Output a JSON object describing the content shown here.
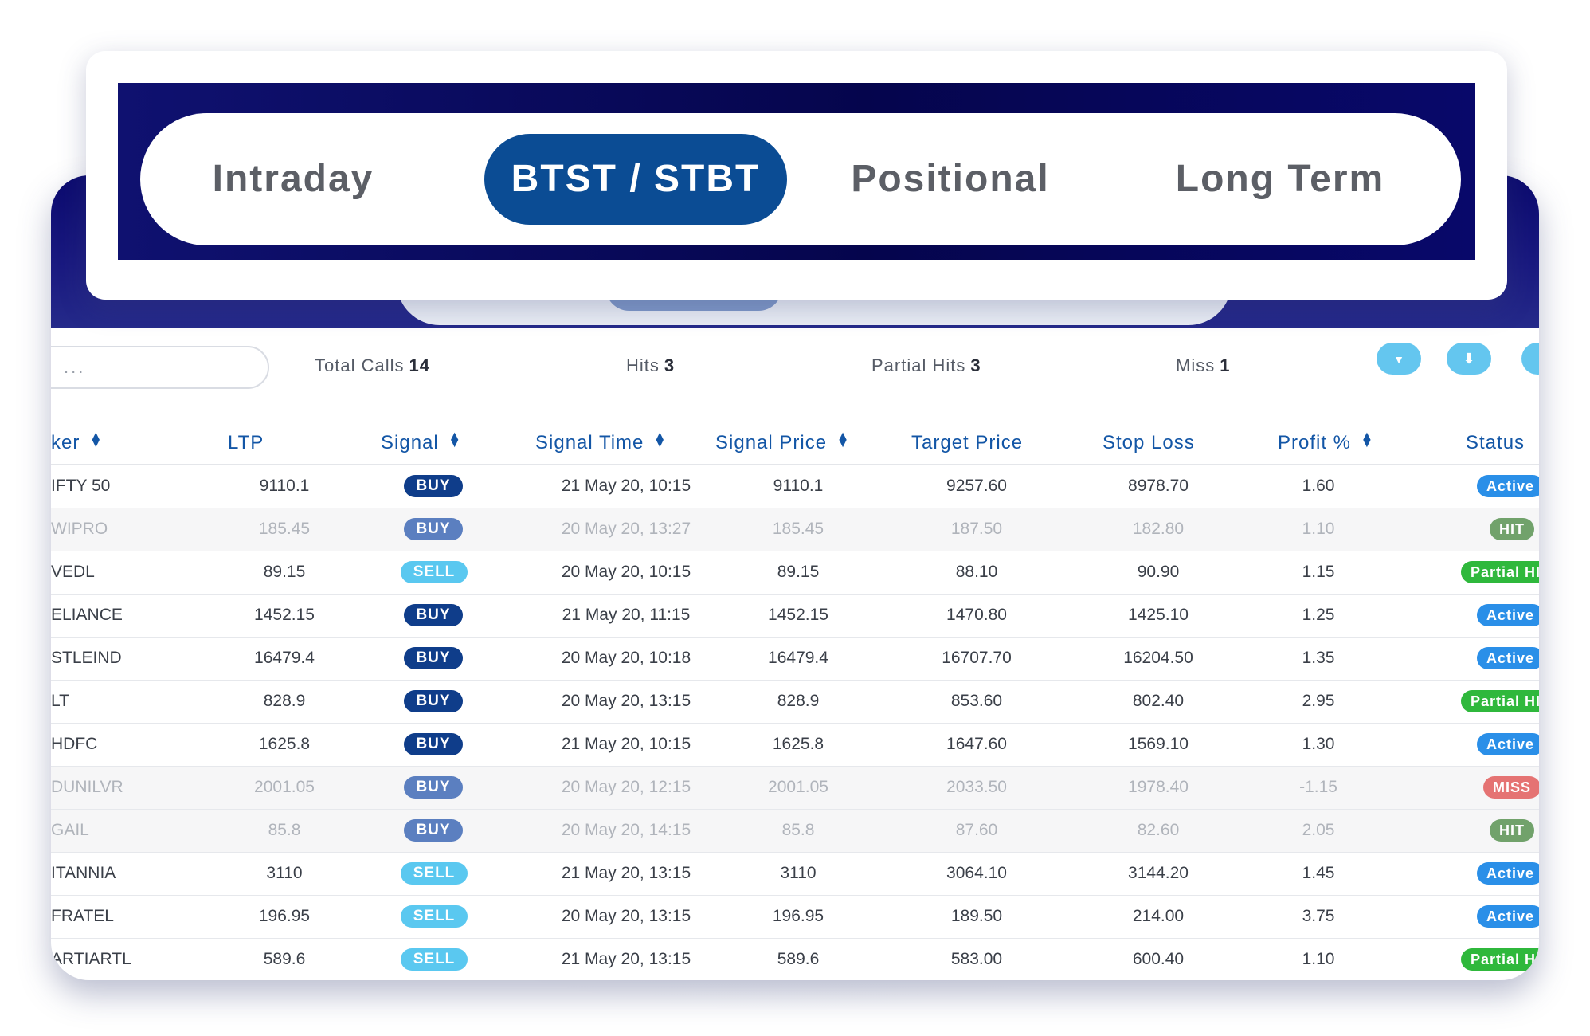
{
  "tabs": {
    "intraday": "Intraday",
    "btst": "BTST / STBT",
    "positional": "Positional",
    "longterm": "Long Term",
    "active": "BTST / STBT"
  },
  "search": {
    "placeholder": "..."
  },
  "stats": {
    "total_calls_label": "Total Calls",
    "total_calls": "14",
    "hits_label": "Hits",
    "hits": "3",
    "partial_label": "Partial Hits",
    "partial": "3",
    "miss_label": "Miss",
    "miss": "1"
  },
  "toolbar": {
    "filter_icon": "filter-icon",
    "download_icon": "download-icon",
    "filter_glyph": "▼",
    "download_glyph": "⬇"
  },
  "columns": {
    "ticker": "ker",
    "ltp": "LTP",
    "signal": "Signal",
    "signal_time": "Signal Time",
    "signal_price": "Signal Price",
    "target_price": "Target Price",
    "stop_loss": "Stop Loss",
    "profit": "Profit %",
    "status": "Status"
  },
  "rows": [
    {
      "ticker": "IFTY 50",
      "ltp": "9110.1",
      "signal": "BUY",
      "time": "21 May 20, 10:15",
      "price": "9110.1",
      "target": "9257.60",
      "stop": "8978.70",
      "profit": "1.60",
      "status": "Active"
    },
    {
      "ticker": "WIPRO",
      "ltp": "185.45",
      "signal": "BUY",
      "time": "20 May 20, 13:27",
      "price": "185.45",
      "target": "187.50",
      "stop": "182.80",
      "profit": "1.10",
      "status": "HIT"
    },
    {
      "ticker": "VEDL",
      "ltp": "89.15",
      "signal": "SELL",
      "time": "20 May 20, 10:15",
      "price": "89.15",
      "target": "88.10",
      "stop": "90.90",
      "profit": "1.15",
      "status": "Partial HI"
    },
    {
      "ticker": "ELIANCE",
      "ltp": "1452.15",
      "signal": "BUY",
      "time": "21 May 20, 11:15",
      "price": "1452.15",
      "target": "1470.80",
      "stop": "1425.10",
      "profit": "1.25",
      "status": "Active"
    },
    {
      "ticker": "STLEIND",
      "ltp": "16479.4",
      "signal": "BUY",
      "time": "20 May 20, 10:18",
      "price": "16479.4",
      "target": "16707.70",
      "stop": "16204.50",
      "profit": "1.35",
      "status": "Active"
    },
    {
      "ticker": "LT",
      "ltp": "828.9",
      "signal": "BUY",
      "time": "20 May 20, 13:15",
      "price": "828.9",
      "target": "853.60",
      "stop": "802.40",
      "profit": "2.95",
      "status": "Partial HI"
    },
    {
      "ticker": "HDFC",
      "ltp": "1625.8",
      "signal": "BUY",
      "time": "21 May 20, 10:15",
      "price": "1625.8",
      "target": "1647.60",
      "stop": "1569.10",
      "profit": "1.30",
      "status": "Active"
    },
    {
      "ticker": "DUNILVR",
      "ltp": "2001.05",
      "signal": "BUY",
      "time": "20 May 20, 12:15",
      "price": "2001.05",
      "target": "2033.50",
      "stop": "1978.40",
      "profit": "-1.15",
      "status": "MISS"
    },
    {
      "ticker": "GAIL",
      "ltp": "85.8",
      "signal": "BUY",
      "time": "20 May 20, 14:15",
      "price": "85.8",
      "target": "87.60",
      "stop": "82.60",
      "profit": "2.05",
      "status": "HIT"
    },
    {
      "ticker": "ITANNIA",
      "ltp": "3110",
      "signal": "SELL",
      "time": "21 May 20, 13:15",
      "price": "3110",
      "target": "3064.10",
      "stop": "3144.20",
      "profit": "1.45",
      "status": "Active"
    },
    {
      "ticker": "FRATEL",
      "ltp": "196.95",
      "signal": "SELL",
      "time": "20 May 20, 13:15",
      "price": "196.95",
      "target": "189.50",
      "stop": "214.00",
      "profit": "3.75",
      "status": "Active"
    },
    {
      "ticker": "ARTIARTL",
      "ltp": "589.6",
      "signal": "SELL",
      "time": "21 May 20, 13:15",
      "price": "589.6",
      "target": "583.00",
      "stop": "600.40",
      "profit": "1.10",
      "status": "Partial HI"
    }
  ]
}
